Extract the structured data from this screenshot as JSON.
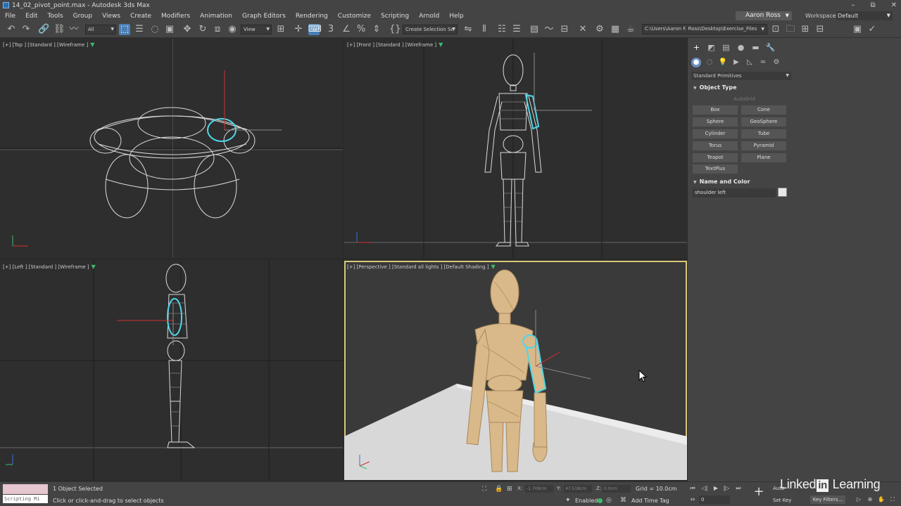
{
  "window": {
    "title": "14_02_pivot_point.max - Autodesk 3ds Max",
    "controls": [
      "–",
      "⧉",
      "✕"
    ]
  },
  "menubar": {
    "items": [
      "File",
      "Edit",
      "Tools",
      "Group",
      "Views",
      "Create",
      "Modifiers",
      "Animation",
      "Graph Editors",
      "Rendering",
      "Customize",
      "Scripting",
      "Arnold",
      "Help"
    ],
    "user": "Aaron Ross",
    "workspaces_label": "Workspaces:",
    "workspace_value": "Default"
  },
  "toolbar": {
    "selection_filter": "All",
    "ref_coord": "View",
    "named_selection": "Create Selection Se",
    "project_path": "C:\\Users\\Aaron F. Ross\\Desktop\\Exercise_Files"
  },
  "viewports": {
    "top": {
      "label": "[+] [Top ] [Standard ] [Wireframe ]"
    },
    "front": {
      "label": "[+] [Front ] [Standard ] [Wireframe ]"
    },
    "left": {
      "label": "[+] [Left ] [Standard ] [Wireframe ]"
    },
    "perspective": {
      "label": "[+] [Perspective ] [Standard all lights ] [Default Shading ]"
    }
  },
  "command_panel": {
    "category": "Standard Primitives",
    "object_type_title": "Object Type",
    "autogrid": "AutoGrid",
    "buttons": [
      "Box",
      "Cone",
      "Sphere",
      "GeoSphere",
      "Cylinder",
      "Tube",
      "Torus",
      "Pyramid",
      "Teapot",
      "Plane",
      "TextPlus"
    ],
    "name_color_title": "Name and Color",
    "object_name": "shoulder left",
    "object_color": "#e8e8e8"
  },
  "statusbar": {
    "script_label": "Scripting Mi",
    "selection_status": "1 Object Selected",
    "prompt": "Click or click-and-drag to select objects",
    "x_label": "X:",
    "x_value": "-1.709cm",
    "y_label": "Y:",
    "y_value": "47.518cm",
    "z_label": "Z:",
    "z_value": "0.0cm",
    "grid": "Grid = 10.0cm",
    "enabled_label": "Enabled:",
    "add_time_tag": "Add Time Tag",
    "frame": "0",
    "auto_key": "Auto",
    "set_key": "Set Key",
    "key_filters": "Key Filters..."
  },
  "watermark": {
    "pre": "Linked",
    "in": "in",
    "post": " Learning"
  },
  "colors": {
    "accent": "#4a7fb3",
    "selection": "#4fd6e8",
    "active_viewport": "#d8c87a",
    "filter_green": "#3dbb6a"
  }
}
